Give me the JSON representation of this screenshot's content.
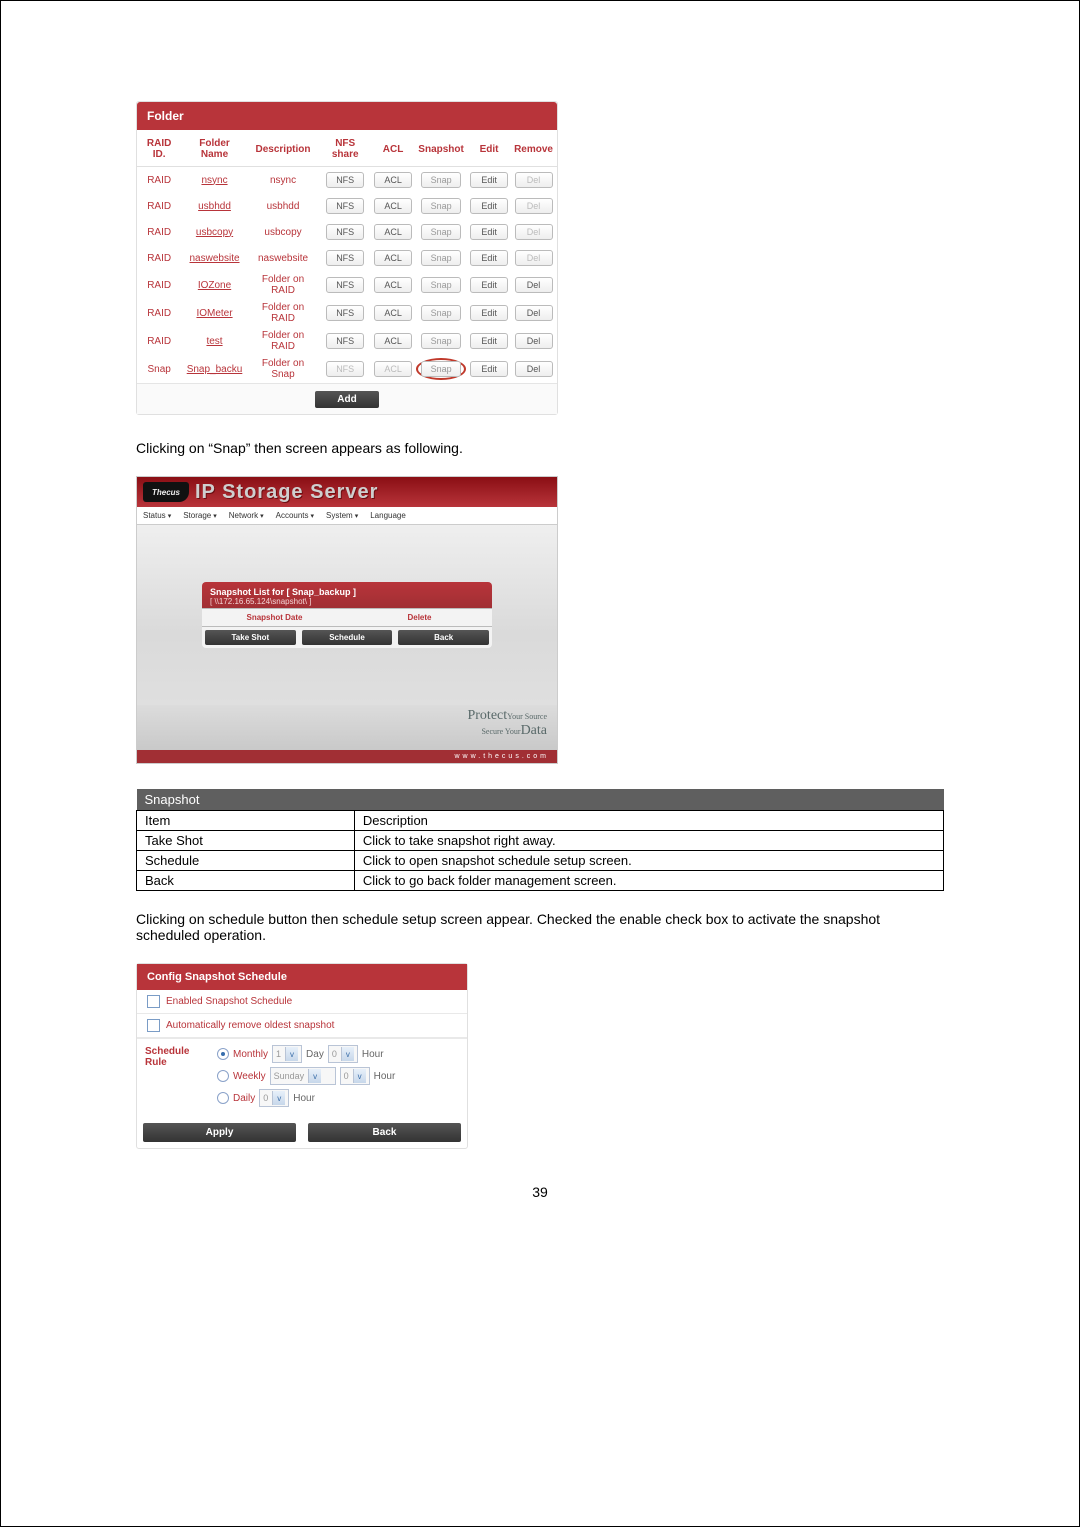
{
  "folder_panel": {
    "title": "Folder",
    "headers": [
      "RAID ID.",
      "Folder Name",
      "Description",
      "NFS share",
      "ACL",
      "Snapshot",
      "Edit",
      "Remove"
    ],
    "rows": [
      {
        "raid": "RAID",
        "name": "nsync",
        "desc": "nsync",
        "nfs": "NFS",
        "acl": "ACL",
        "snap": "Snap",
        "edit": "Edit",
        "del": "Del",
        "del_dis": true
      },
      {
        "raid": "RAID",
        "name": "usbhdd",
        "desc": "usbhdd",
        "nfs": "NFS",
        "acl": "ACL",
        "snap": "Snap",
        "edit": "Edit",
        "del": "Del",
        "del_dis": true
      },
      {
        "raid": "RAID",
        "name": "usbcopy",
        "desc": "usbcopy",
        "nfs": "NFS",
        "acl": "ACL",
        "snap": "Snap",
        "edit": "Edit",
        "del": "Del",
        "del_dis": true
      },
      {
        "raid": "RAID",
        "name": "naswebsite",
        "desc": "naswebsite",
        "nfs": "NFS",
        "acl": "ACL",
        "snap": "Snap",
        "edit": "Edit",
        "del": "Del",
        "del_dis": true
      },
      {
        "raid": "RAID",
        "name": "IOZone",
        "desc": "Folder on RAID",
        "nfs": "NFS",
        "acl": "ACL",
        "snap": "Snap",
        "edit": "Edit",
        "del": "Del",
        "del_dis": false
      },
      {
        "raid": "RAID",
        "name": "IOMeter",
        "desc": "Folder on RAID",
        "nfs": "NFS",
        "acl": "ACL",
        "snap": "Snap",
        "edit": "Edit",
        "del": "Del",
        "del_dis": false
      },
      {
        "raid": "RAID",
        "name": "test",
        "desc": "Folder on RAID",
        "nfs": "NFS",
        "acl": "ACL",
        "snap": "Snap",
        "edit": "Edit",
        "del": "Del",
        "del_dis": false
      },
      {
        "raid": "Snap",
        "name": "Snap_backu",
        "desc": "Folder on Snap",
        "nfs": "NFS",
        "acl": "ACL",
        "snap": "Snap",
        "edit": "Edit",
        "del": "Del",
        "del_dis": false,
        "snap_highlight": true,
        "nfs_dis": true,
        "acl_dis": true
      }
    ],
    "add_label": "Add"
  },
  "para1": "Clicking on “Snap” then screen appears as following.",
  "ips": {
    "brand": "Thecus",
    "title": "IP Storage Server",
    "menu": [
      "Status",
      "Storage",
      "Network",
      "Accounts",
      "System",
      "Language"
    ],
    "snap_title": "Snapshot List for [ Snap_backup ]",
    "snap_path": "[ \\\\172.16.65.124\\snapshot\\ ]",
    "col_date": "Snapshot Date",
    "col_del": "Delete",
    "btn_take": "Take Shot",
    "btn_schedule": "Schedule",
    "btn_back": "Back",
    "protect1": "Protect",
    "protect1s": "Your Source",
    "protect2a": "Secure Your",
    "protect2b": "Data",
    "url": "www.thecus.com"
  },
  "desc_table": {
    "title": "Snapshot",
    "head_item": "Item",
    "head_desc": "Description",
    "rows": [
      {
        "item": "Take Shot",
        "desc": "Click to take snapshot right away."
      },
      {
        "item": "Schedule",
        "desc": "Click to open snapshot schedule setup screen."
      },
      {
        "item": "Back",
        "desc": "Click to go back folder management screen."
      }
    ]
  },
  "para2": "Clicking on schedule button then schedule setup screen appear. Checked the enable check box to activate the snapshot scheduled operation.",
  "sched": {
    "title": "Config Snapshot Schedule",
    "cb1": "Enabled Snapshot Schedule",
    "cb2": "Automatically remove oldest snapshot",
    "rule_label": "Schedule Rule",
    "monthly": "Monthly",
    "weekly": "Weekly",
    "daily": "Daily",
    "day_val": "1",
    "day_unit": "Day",
    "hour_val": "0",
    "hour_unit": "Hour",
    "weekly_day": "Sunday",
    "apply": "Apply",
    "back": "Back"
  },
  "page_number": "39"
}
